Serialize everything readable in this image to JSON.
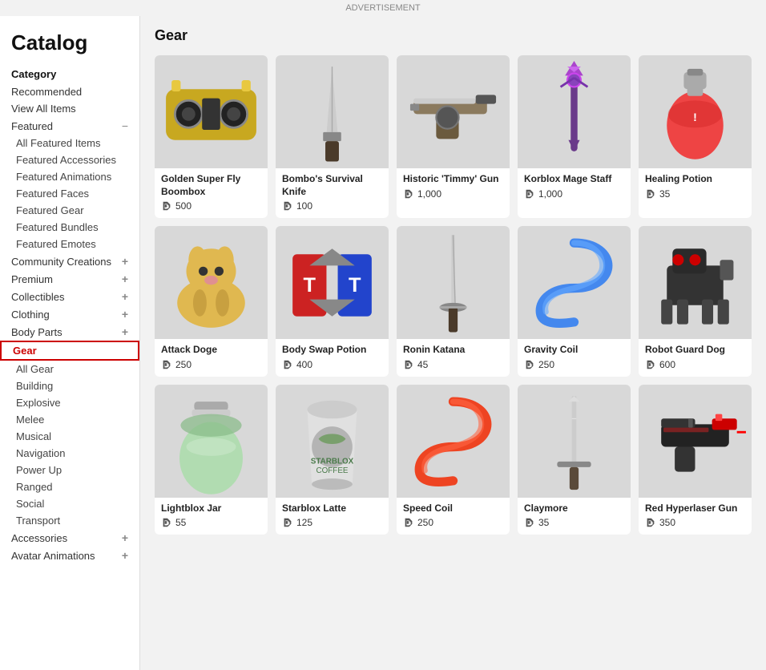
{
  "app": {
    "title": "Catalog",
    "ad_label": "ADVERTISEMENT"
  },
  "sidebar": {
    "category_label": "Category",
    "items": [
      {
        "id": "recommended",
        "label": "Recommended",
        "level": "top",
        "expandable": false
      },
      {
        "id": "view-all",
        "label": "View All Items",
        "level": "top",
        "expandable": false
      },
      {
        "id": "featured",
        "label": "Featured",
        "level": "top",
        "expandable": true,
        "expanded": true,
        "collapse_icon": "−"
      },
      {
        "id": "all-featured",
        "label": "All Featured Items",
        "level": "sub",
        "expandable": false
      },
      {
        "id": "featured-accessories",
        "label": "Featured Accessories",
        "level": "sub",
        "expandable": false
      },
      {
        "id": "featured-animations",
        "label": "Featured Animations",
        "level": "sub",
        "expandable": false
      },
      {
        "id": "featured-faces",
        "label": "Featured Faces",
        "level": "sub",
        "expandable": false
      },
      {
        "id": "featured-gear",
        "label": "Featured Gear",
        "level": "sub",
        "expandable": false
      },
      {
        "id": "featured-bundles",
        "label": "Featured Bundles",
        "level": "sub",
        "expandable": false
      },
      {
        "id": "featured-emotes",
        "label": "Featured Emotes",
        "level": "sub",
        "expandable": false
      },
      {
        "id": "community-creations",
        "label": "Community Creations",
        "level": "top",
        "expandable": true,
        "expand_icon": "+"
      },
      {
        "id": "premium",
        "label": "Premium",
        "level": "top",
        "expandable": true,
        "expand_icon": "+"
      },
      {
        "id": "collectibles",
        "label": "Collectibles",
        "level": "top",
        "expandable": true,
        "expand_icon": "+"
      },
      {
        "id": "clothing",
        "label": "Clothing",
        "level": "top",
        "expandable": true,
        "expand_icon": "+"
      },
      {
        "id": "body-parts",
        "label": "Body Parts",
        "level": "top",
        "expandable": true,
        "expand_icon": "+"
      },
      {
        "id": "gear",
        "label": "Gear",
        "level": "top",
        "expandable": false,
        "active": true
      },
      {
        "id": "all-gear",
        "label": "All Gear",
        "level": "sub",
        "expandable": false
      },
      {
        "id": "building",
        "label": "Building",
        "level": "sub",
        "expandable": false
      },
      {
        "id": "explosive",
        "label": "Explosive",
        "level": "sub",
        "expandable": false
      },
      {
        "id": "melee",
        "label": "Melee",
        "level": "sub",
        "expandable": false
      },
      {
        "id": "musical",
        "label": "Musical",
        "level": "sub",
        "expandable": false
      },
      {
        "id": "navigation",
        "label": "Navigation",
        "level": "sub",
        "expandable": false
      },
      {
        "id": "power-up",
        "label": "Power Up",
        "level": "sub",
        "expandable": false
      },
      {
        "id": "ranged",
        "label": "Ranged",
        "level": "sub",
        "expandable": false
      },
      {
        "id": "social",
        "label": "Social",
        "level": "sub",
        "expandable": false
      },
      {
        "id": "transport",
        "label": "Transport",
        "level": "sub",
        "expandable": false
      },
      {
        "id": "accessories",
        "label": "Accessories",
        "level": "top",
        "expandable": true,
        "expand_icon": "+"
      },
      {
        "id": "avatar-animations",
        "label": "Avatar Animations",
        "level": "top",
        "expandable": true,
        "expand_icon": "+"
      }
    ]
  },
  "main": {
    "section_title": "Gear",
    "items": [
      {
        "id": 1,
        "name": "Golden Super Fly Boombox",
        "price": "500",
        "color1": "#c8a820",
        "color2": "#e8c840",
        "shape": "boombox"
      },
      {
        "id": 2,
        "name": "Bombo's Survival Knife",
        "price": "100",
        "color1": "#222",
        "color2": "#555",
        "shape": "knife"
      },
      {
        "id": 3,
        "name": "Historic 'Timmy' Gun",
        "price": "1,000",
        "color1": "#6b5a3e",
        "color2": "#8b7a5e",
        "shape": "tommy-gun"
      },
      {
        "id": 4,
        "name": "Korblox Mage Staff",
        "price": "1,000",
        "color1": "#1a1a2e",
        "color2": "#4a0080",
        "shape": "staff"
      },
      {
        "id": 5,
        "name": "Healing Potion",
        "price": "35",
        "color1": "#cc2222",
        "color2": "#ee4444",
        "shape": "potion"
      },
      {
        "id": 6,
        "name": "Attack Doge",
        "price": "250",
        "color1": "#c8a040",
        "color2": "#e0b850",
        "shape": "doge"
      },
      {
        "id": 7,
        "name": "Body Swap Potion",
        "price": "400",
        "color1": "#cc2222",
        "color2": "#2244cc",
        "shape": "body-swap"
      },
      {
        "id": 8,
        "name": "Ronin Katana",
        "price": "45",
        "color1": "#888",
        "color2": "#aaa",
        "shape": "katana"
      },
      {
        "id": 9,
        "name": "Gravity Coil",
        "price": "250",
        "color1": "#4488ee",
        "color2": "#66aaff",
        "shape": "coil-blue"
      },
      {
        "id": 10,
        "name": "Robot Guard Dog",
        "price": "600",
        "color1": "#222",
        "color2": "#444",
        "shape": "robot-dog"
      },
      {
        "id": 11,
        "name": "Lightblox Jar",
        "price": "55",
        "color1": "#88bb88",
        "color2": "#aaddaa",
        "shape": "jar"
      },
      {
        "id": 12,
        "name": "Starblox Latte",
        "price": "125",
        "color1": "#888888",
        "color2": "#aaaaaa",
        "shape": "latte"
      },
      {
        "id": 13,
        "name": "Speed Coil",
        "price": "250",
        "color1": "#ee4422",
        "color2": "#ff6644",
        "shape": "coil-red"
      },
      {
        "id": 14,
        "name": "Claymore",
        "price": "35",
        "color1": "#999",
        "color2": "#bbb",
        "shape": "sword"
      },
      {
        "id": 15,
        "name": "Red Hyperlaser Gun",
        "price": "350",
        "color1": "#cc0000",
        "color2": "#ff2222",
        "shape": "laser-gun"
      }
    ]
  }
}
